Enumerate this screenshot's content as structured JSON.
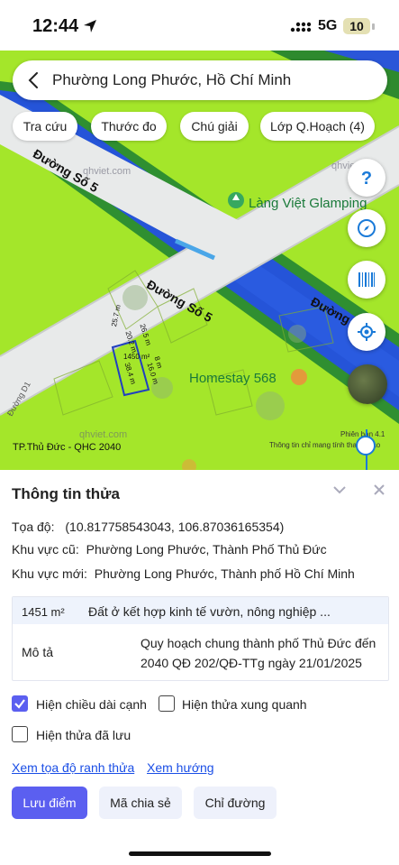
{
  "status": {
    "time": "12:44",
    "network": "5G",
    "battery": "10"
  },
  "search": {
    "title": "Phường Long Phước, Hồ Chí Minh"
  },
  "chips": [
    "Tra cứu",
    "Thước đo",
    "Chú giải",
    "Lớp Q.Hoạch (4)"
  ],
  "map": {
    "road_name_1": "Đường Số 5",
    "road_name_2": "Đường Số 5",
    "road_name_3": "Đường",
    "poi_1": "Làng Việt Glamping",
    "poi_2": "Homestay 568",
    "watermark_1": "qhviet.com",
    "watermark_2": "qhviet.com",
    "watermark_3": "qhviet.com",
    "plan_label": "TP.Thủ Đức - QHC 2040",
    "disclaimer": "Thông tin chỉ mang tính tham khảo",
    "scale_text": "Phiên bản 4.1",
    "plot_area": "1450 m²",
    "edge_1": "25.7 m",
    "edge_2": "20.2 m",
    "edge_3": "26.5 m",
    "edge_4": "38.4 m",
    "edge_5": "16.0 m",
    "edge_6": "8 m",
    "road_side_label": "Đường D1"
  },
  "colors": {
    "land": "#a4e62a",
    "road": "#e8e8e8",
    "river": "#2554d8",
    "accent": "#5b5ff0"
  },
  "panel": {
    "title": "Thông tin thửa",
    "coord_label": "Tọa độ:",
    "coord_value": "(10.817758543043, 106.87036165354)",
    "old_area_label": "Khu vực cũ:",
    "old_area_value": "Phường Long Phước, Thành Phố Thủ Đức",
    "new_area_label": "Khu vực mới:",
    "new_area_value": "Phường Long Phước, Thành phố Hồ Chí Minh",
    "area": "1451 m²",
    "land_type": "Đất ở kết hợp kinh tế vườn, nông nghiệp ...",
    "desc_label": "Mô tả",
    "desc_line1": "Quy hoạch chung thành phố Thủ Đức đến",
    "desc_line2": "2040 QĐ 202/QĐ-TTg ngày 21/01/2025",
    "cb_edges": "Hiện chiều dài cạnh",
    "cb_neighbors": "Hiện thửa xung quanh",
    "cb_saved": "Hiện thửa đã lưu",
    "cb_edges_checked": true,
    "link_coords": "Xem tọa độ ranh thửa",
    "link_direction": "Xem hướng",
    "btn_save": "Lưu điểm",
    "btn_share": "Mã chia sẻ",
    "btn_route": "Chỉ đường"
  }
}
